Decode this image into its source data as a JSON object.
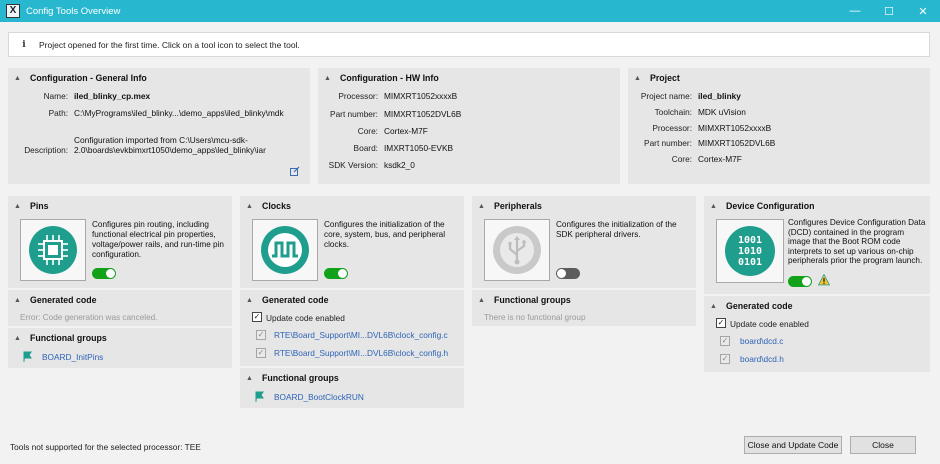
{
  "window": {
    "title": "Config Tools Overview",
    "controls": {
      "minimize": "—",
      "maximize": "☐",
      "close": "✕"
    },
    "app_icon_glyph": "X"
  },
  "info_bar": {
    "text": "Project opened for the first time. Click on a tool icon to select the tool."
  },
  "general_info": {
    "title": "Configuration - General Info",
    "rows": [
      {
        "key": "Name:",
        "value": "iled_blinky_cp.mex"
      },
      {
        "key": "Path:",
        "value": "C:\\MyPrograms\\iled_blinky...\\demo_apps\\iled_blinky\\mdk"
      },
      {
        "key": "Description:",
        "value": "Configuration imported from C:\\Users\\mcu-sdk-2.0\\boards\\evkbimxrt1050\\demo_apps\\led_blinky\\iar"
      }
    ],
    "edit_icon": "edit-icon"
  },
  "hw_info": {
    "title": "Configuration - HW Info",
    "rows": [
      {
        "key": "Processor:",
        "value": "MIMXRT1052xxxxB"
      },
      {
        "key": "Part number:",
        "value": "MIMXRT1052DVL6B"
      },
      {
        "key": "Core:",
        "value": "Cortex-M7F"
      },
      {
        "key": "Board:",
        "value": "IMXRT1050-EVKB"
      },
      {
        "key": "SDK Version:",
        "value": "ksdk2_0"
      }
    ]
  },
  "project": {
    "title": "Project",
    "rows": [
      {
        "key": "Project name:",
        "value": "iled_blinky"
      },
      {
        "key": "Toolchain:",
        "value": "MDK uVision"
      },
      {
        "key": "Processor:",
        "value": "MIMXRT1052xxxxB"
      },
      {
        "key": "Part number:",
        "value": "MIMXRT1052DVL6B"
      },
      {
        "key": "Core:",
        "value": "Cortex-M7F"
      }
    ]
  },
  "tools": {
    "pins": {
      "title": "Pins",
      "description": "Configures pin routing, including functional  electrical pin properties, voltage/power rails, and run-time pin configuration.",
      "enabled": true,
      "generated_code_title": "Generated code",
      "generated_code_status": "Error: Code generation was canceled.",
      "functional_groups_title": "Functional groups",
      "functional_groups": [
        "BOARD_InitPins"
      ]
    },
    "clocks": {
      "title": "Clocks",
      "description": "Configures the initialization of the core, system, bus, and peripheral clocks.",
      "enabled": true,
      "generated_code_title": "Generated code",
      "update_label": "Update code enabled",
      "files": [
        "RTE\\Board_Support\\MI...DVL6B\\clock_config.c",
        "RTE\\Board_Support\\MI...DVL6B\\clock_config.h"
      ],
      "functional_groups_title": "Functional groups",
      "functional_groups": [
        "BOARD_BootClockRUN"
      ]
    },
    "peripherals": {
      "title": "Peripherals",
      "description": "Configures the initialization of the SDK peripheral drivers.",
      "enabled": false,
      "functional_groups_title": "Functional groups",
      "functional_groups_status": "There is no functional group"
    },
    "device_config": {
      "title": "Device Configuration",
      "description": "Configures Device Configuration Data (DCD) contained in the program image that the Boot ROM code interprets to set up various on-chip peripherals prior the program launch.",
      "enabled": true,
      "tile_text": [
        "1001",
        "1010",
        "0101"
      ],
      "generated_code_title": "Generated code",
      "update_label": "Update code enabled",
      "files": [
        "board\\dcd.c",
        "board\\dcd.h"
      ]
    }
  },
  "status_bar": {
    "text": "Tools not supported for the selected processor: TEE"
  },
  "buttons": {
    "close_update": "Close and Update Code",
    "close": "Close"
  },
  "colors": {
    "titlebar": "#27b8d0",
    "accent": "#1f9e8e",
    "toggle_on": "#11a21a",
    "link": "#2d63b8"
  }
}
